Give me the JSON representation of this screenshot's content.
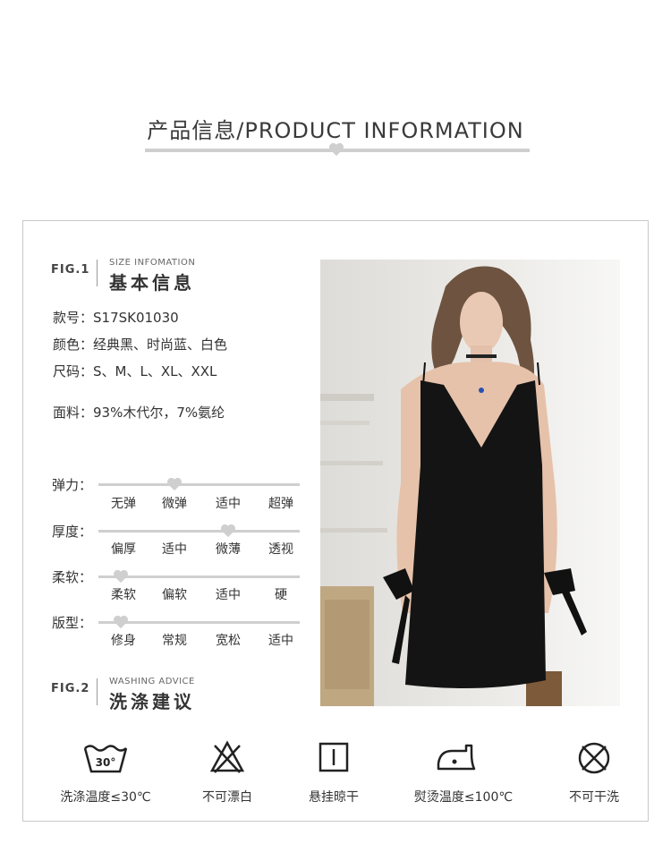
{
  "header": {
    "title": "产品信息/PRODUCT INFORMATION"
  },
  "fig1": {
    "num": "FIG.1",
    "subtitle": "SIZE INFOMATION",
    "title": "基本信息"
  },
  "info": {
    "style_no": "款号：S17SK01030",
    "colors": "颜色：经典黑、时尚蓝、白色",
    "sizes": "尺码：S、M、L、XL、XXL",
    "fabric": "面料：93%木代尔，7%氨纶"
  },
  "scales": [
    {
      "label": "弹力：",
      "options": [
        "无弹",
        "微弹",
        "适中",
        "超弹"
      ],
      "selected": "微弹"
    },
    {
      "label": "厚度：",
      "options": [
        "偏厚",
        "适中",
        "微薄",
        "透视"
      ],
      "selected": "微薄"
    },
    {
      "label": "柔软：",
      "options": [
        "柔软",
        "偏软",
        "适中",
        "硬"
      ],
      "selected": "柔软"
    },
    {
      "label": "版型：",
      "options": [
        "修身",
        "常规",
        "宽松",
        "适中"
      ],
      "selected": "修身"
    }
  ],
  "fig2": {
    "num": "FIG.2",
    "subtitle": "WASHING ADVICE",
    "title": "洗涤建议"
  },
  "washing": [
    {
      "icon": "wash-30-icon",
      "label": "洗涤温度≤30℃",
      "temp": "30°"
    },
    {
      "icon": "no-bleach-icon",
      "label": "不可漂白"
    },
    {
      "icon": "hang-dry-icon",
      "label": "悬挂晾干"
    },
    {
      "icon": "iron-icon",
      "label": "熨烫温度≤100℃"
    },
    {
      "icon": "no-dry-clean-icon",
      "label": "不可干洗"
    }
  ],
  "colors": {
    "bar": "#cfcfcf",
    "heart": "#cfcfcf",
    "text": "#333333",
    "frame": "#c9c9c9"
  }
}
